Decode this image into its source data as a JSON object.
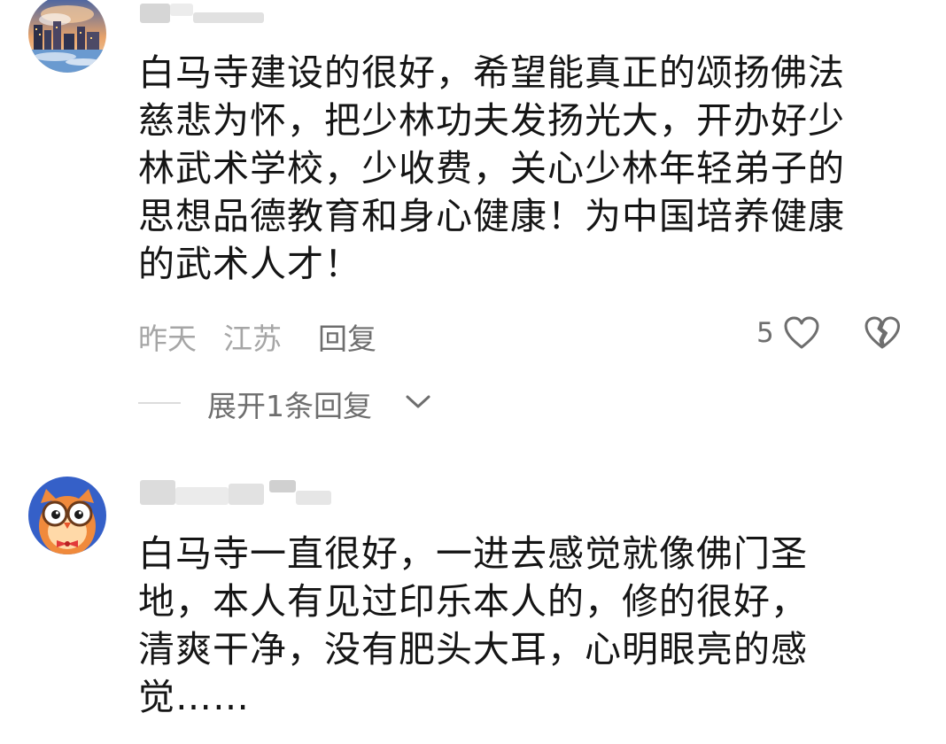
{
  "comments": [
    {
      "text": "白马寺建设的很好，希望能真正的颂扬佛法慈悲为怀，把少林功夫发扬光大，开办好少林武术学校，少收费，关心少林年轻弟子的思想品德教育和身心健康！为中国培养健康的武术人才！",
      "lines": [
        "白马寺建设的很好，希望能真正的颂扬佛法",
        "慈悲为怀，把少林功夫发扬光大，开办好少",
        "林武术学校，少收费，关心少林年轻弟子的",
        "思想品德教育和身心健康！为中国培养健康",
        "的武术人才！"
      ],
      "time": "昨天",
      "location": "江苏",
      "reply_label": "回复",
      "like_count": "5",
      "expand_replies_label": "展开1条回复"
    },
    {
      "text": "白马寺一直很好，一进去感觉就像佛门圣地，本人有见过印乐本人的，修的很好，清爽干净，没有肥头大耳，心明眼亮的感觉……",
      "lines": [
        "白马寺一直很好，一进去感觉就像佛门圣",
        "地，本人有见过印乐本人的，修的很好，",
        "清爽干净，没有肥头大耳，心明眼亮的感",
        "觉……"
      ]
    }
  ],
  "icons": {
    "like": "heart-outline-icon",
    "dislike": "broken-heart-icon",
    "expand": "chevron-down-icon"
  },
  "colors": {
    "text_primary": "#151515",
    "text_meta": "#a6a6a6",
    "text_action": "#6e6e6e",
    "owl_avatar_bg": "#3560c8"
  }
}
